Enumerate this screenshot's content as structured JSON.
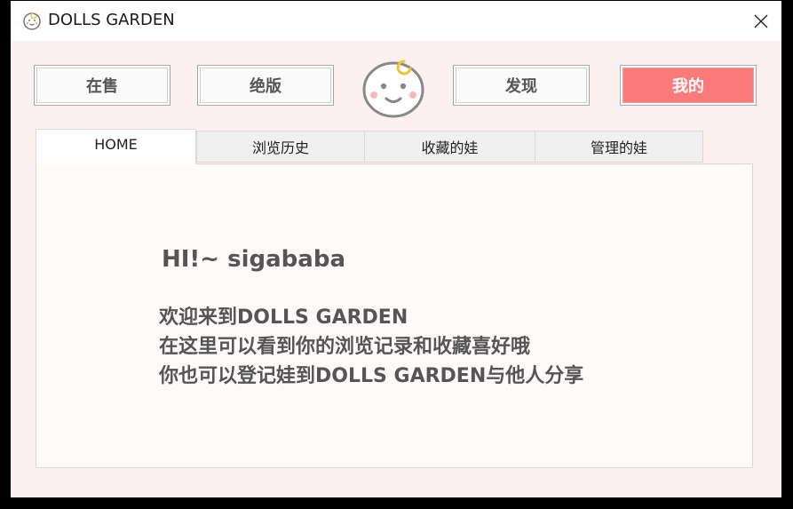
{
  "window": {
    "title": "DOLLS GARDEN",
    "title_icon": "baby-face-icon",
    "close_icon": "close-icon"
  },
  "nav": {
    "buttons": [
      {
        "label": "在售",
        "active": false
      },
      {
        "label": "绝版",
        "active": false
      },
      {
        "label": "发现",
        "active": false
      },
      {
        "label": "我的",
        "active": true
      }
    ],
    "logo_icon": "baby-face-icon"
  },
  "tabs": [
    {
      "label": "HOME",
      "active": true
    },
    {
      "label": "浏览历史",
      "active": false
    },
    {
      "label": "收藏的娃",
      "active": false
    },
    {
      "label": "管理的娃",
      "active": false
    }
  ],
  "home": {
    "greeting": "HI!~ sigababa",
    "lines": [
      "欢迎来到DOLLS GARDEN",
      "在这里可以看到你的浏览记录和收藏喜好哦",
      "你也可以登记娃到DOLLS GARDEN与他人分享"
    ]
  },
  "colors": {
    "background": "#fdf0f0",
    "accent": "#fb7b7d",
    "text": "#555555"
  }
}
